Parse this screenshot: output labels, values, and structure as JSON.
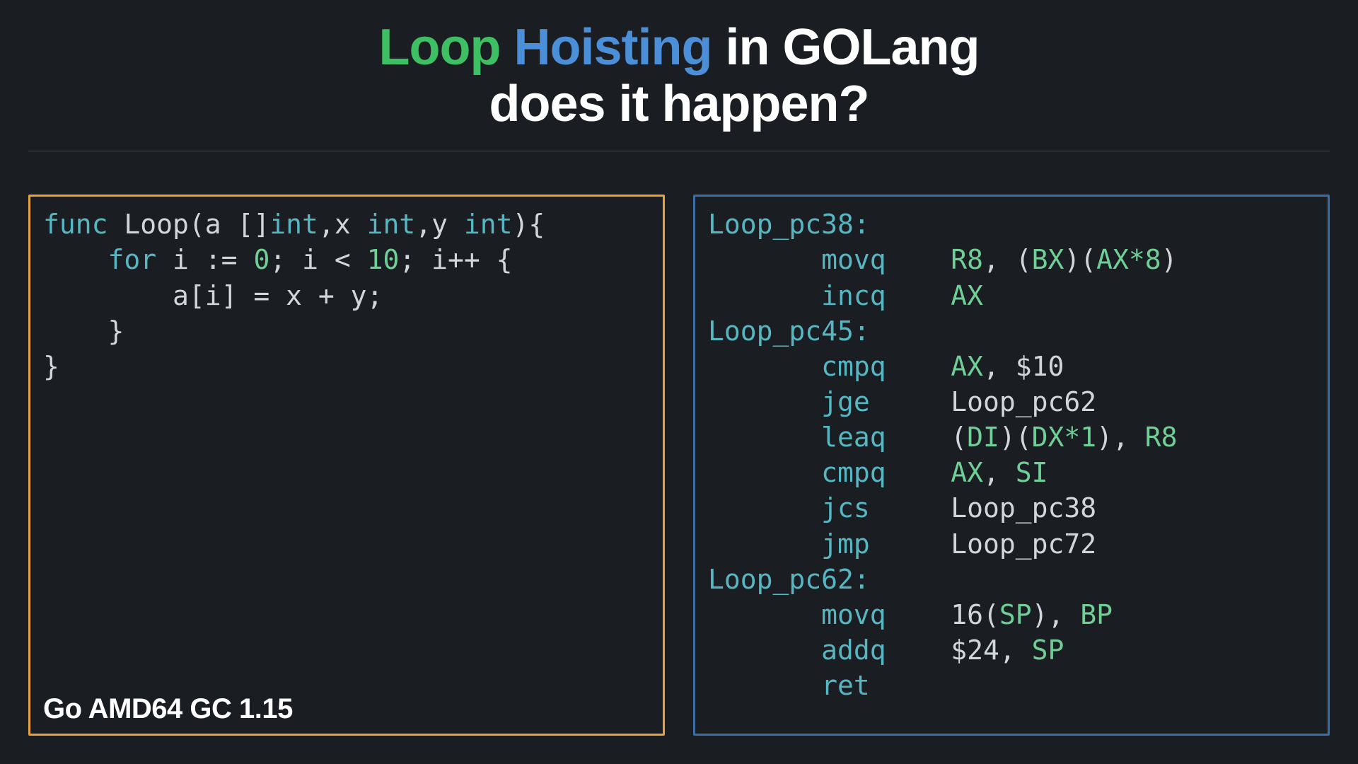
{
  "title": {
    "part1": "Loop",
    "part2": "Hoisting",
    "part3": "in GOLang",
    "line2": "does it happen?"
  },
  "source": {
    "caption": "Go AMD64 GC 1.15",
    "lines": {
      "l1_func": "func",
      "l1_name": " Loop(a []",
      "l1_int1": "int",
      "l1_mid1": ",x ",
      "l1_int2": "int",
      "l1_mid2": ",y ",
      "l1_int3": "int",
      "l1_end": "){",
      "l2_for": "    for",
      "l2_a": " i := ",
      "l2_zero": "0",
      "l2_b": "; i < ",
      "l2_ten": "10",
      "l2_c": "; i++ {",
      "l3": "        a[i] = x + y;",
      "l4": "    }",
      "l5": "}"
    }
  },
  "asm": {
    "rows": [
      {
        "label": "Loop_pc38:"
      },
      {
        "mn": "movq",
        "op1": {
          "reg": "R8"
        },
        "comma": ", ",
        "op2": {
          "mem_open": "(",
          "reg1": "BX",
          "mid": ")(",
          "reg2": "AX",
          "scale": "*8",
          "close": ")"
        }
      },
      {
        "mn": "incq",
        "op1": {
          "reg": "AX"
        }
      },
      {
        "label": "Loop_pc45:"
      },
      {
        "mn": "cmpq",
        "op1": {
          "reg": "AX"
        },
        "comma": ", ",
        "op2": {
          "imm": "$10"
        }
      },
      {
        "mn": "jge",
        "op1": {
          "lblref": "Loop_pc62"
        }
      },
      {
        "mn": "leaq",
        "op1": {
          "mem_open": "(",
          "reg1": "DI",
          "mid": ")(",
          "reg2": "DX",
          "scale": "*1",
          "close": ")"
        },
        "comma": ", ",
        "op2": {
          "reg": "R8"
        }
      },
      {
        "mn": "cmpq",
        "op1": {
          "reg": "AX"
        },
        "comma": ", ",
        "op2": {
          "reg": "SI"
        }
      },
      {
        "mn": "jcs",
        "op1": {
          "lblref": "Loop_pc38"
        }
      },
      {
        "mn": "jmp",
        "op1": {
          "lblref": "Loop_pc72"
        }
      },
      {
        "label": "Loop_pc62:"
      },
      {
        "mn": "movq",
        "op1": {
          "memraw": "16(",
          "reg1": "SP",
          "close": ")"
        },
        "comma": ", ",
        "op2": {
          "reg": "BP"
        }
      },
      {
        "mn": "addq",
        "op1": {
          "imm": "$24"
        },
        "comma": ", ",
        "op2": {
          "reg": "SP"
        }
      },
      {
        "mn": "ret"
      }
    ]
  }
}
